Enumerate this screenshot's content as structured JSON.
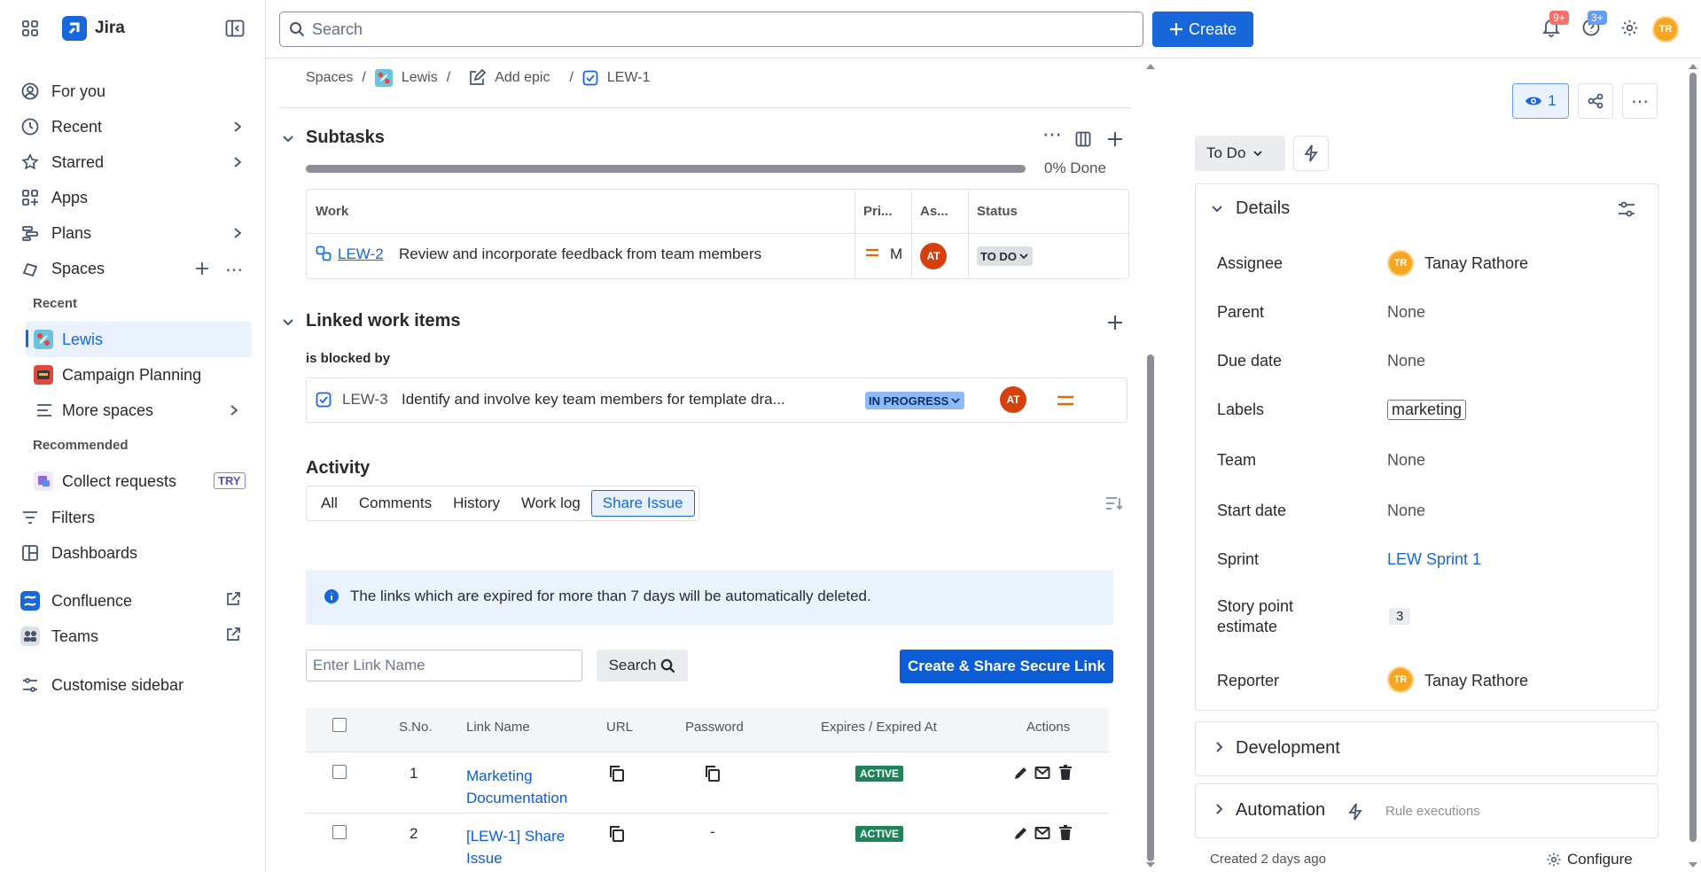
{
  "app": {
    "name": "Jira"
  },
  "sidebar": {
    "items": [
      {
        "label": "For you"
      },
      {
        "label": "Recent"
      },
      {
        "label": "Starred"
      },
      {
        "label": "Apps"
      },
      {
        "label": "Plans"
      },
      {
        "label": "Spaces"
      }
    ],
    "recent_label": "Recent",
    "recent_spaces": [
      {
        "label": "Lewis"
      },
      {
        "label": "Campaign Planning"
      },
      {
        "label": "More spaces"
      }
    ],
    "recommended_label": "Recommended",
    "recommended": {
      "label": "Collect requests",
      "tag": "TRY"
    },
    "filters": "Filters",
    "dashboards": "Dashboards",
    "confluence": "Confluence",
    "teams": "Teams",
    "customise": "Customise sidebar"
  },
  "topbar": {
    "search_placeholder": "Search",
    "create_label": "Create",
    "notif_badge": "9+",
    "help_badge": "3+",
    "user_initials": "TR"
  },
  "breadcrumb": {
    "spaces": "Spaces",
    "project": "Lewis",
    "add_epic": "Add epic",
    "issue": "LEW-1",
    "sep": "/"
  },
  "subtasks": {
    "title": "Subtasks",
    "progress_pct": 0,
    "progress_label": "0% Done",
    "columns": [
      "Work",
      "Pri...",
      "As...",
      "Status"
    ],
    "rows": [
      {
        "key": "LEW-2",
        "summary": "Review and incorporate feedback from team members",
        "priority": "M",
        "assignee": "AT",
        "status": "TO DO"
      }
    ]
  },
  "linked": {
    "title": "Linked work items",
    "relation": "is blocked by",
    "item": {
      "key": "LEW-3",
      "summary": "Identify and involve key team members for template dra...",
      "status": "IN PROGRESS",
      "assignee": "AT"
    }
  },
  "activity": {
    "title": "Activity",
    "tabs": [
      "All",
      "Comments",
      "History",
      "Work log",
      "Share Issue"
    ],
    "active_tab": "Share Issue",
    "info": "The links which are expired for more than 7 days will be automatically deleted.",
    "link_name_placeholder": "Enter Link Name",
    "search_label": "Search",
    "create_share_label": "Create & Share Secure Link",
    "table_columns": [
      "S.No.",
      "Link Name",
      "URL",
      "Password",
      "Expires / Expired At",
      "Actions"
    ],
    "rows": [
      {
        "sno": "1",
        "name_line1": "Marketing",
        "name_line2": "Documentation",
        "password": "",
        "status": "ACTIVE"
      },
      {
        "sno": "2",
        "name_line1": "[LEW-1] Share",
        "name_line2": "Issue",
        "password": "-",
        "status": "ACTIVE"
      }
    ]
  },
  "right": {
    "watch_count": "1",
    "status": "To Do",
    "details_title": "Details",
    "fields": {
      "assignee_label": "Assignee",
      "assignee": "Tanay Rathore",
      "assignee_initials": "TR",
      "parent_label": "Parent",
      "parent": "None",
      "due_label": "Due date",
      "due": "None",
      "labels_label": "Labels",
      "labels": "marketing",
      "team_label": "Team",
      "team": "None",
      "start_label": "Start date",
      "start": "None",
      "sprint_label": "Sprint",
      "sprint": "LEW Sprint 1",
      "sp_label_1": "Story point",
      "sp_label_2": "estimate",
      "sp": "3",
      "reporter_label": "Reporter",
      "reporter": "Tanay Rathore",
      "reporter_initials": "TR"
    },
    "development": "Development",
    "automation": "Automation",
    "rule_exec": "Rule executions",
    "created": "Created 2 days ago",
    "configure": "Configure"
  },
  "colors": {
    "accent": "#1868db",
    "active_green": "#1f845a",
    "avatar_orange": "#f5a623"
  }
}
